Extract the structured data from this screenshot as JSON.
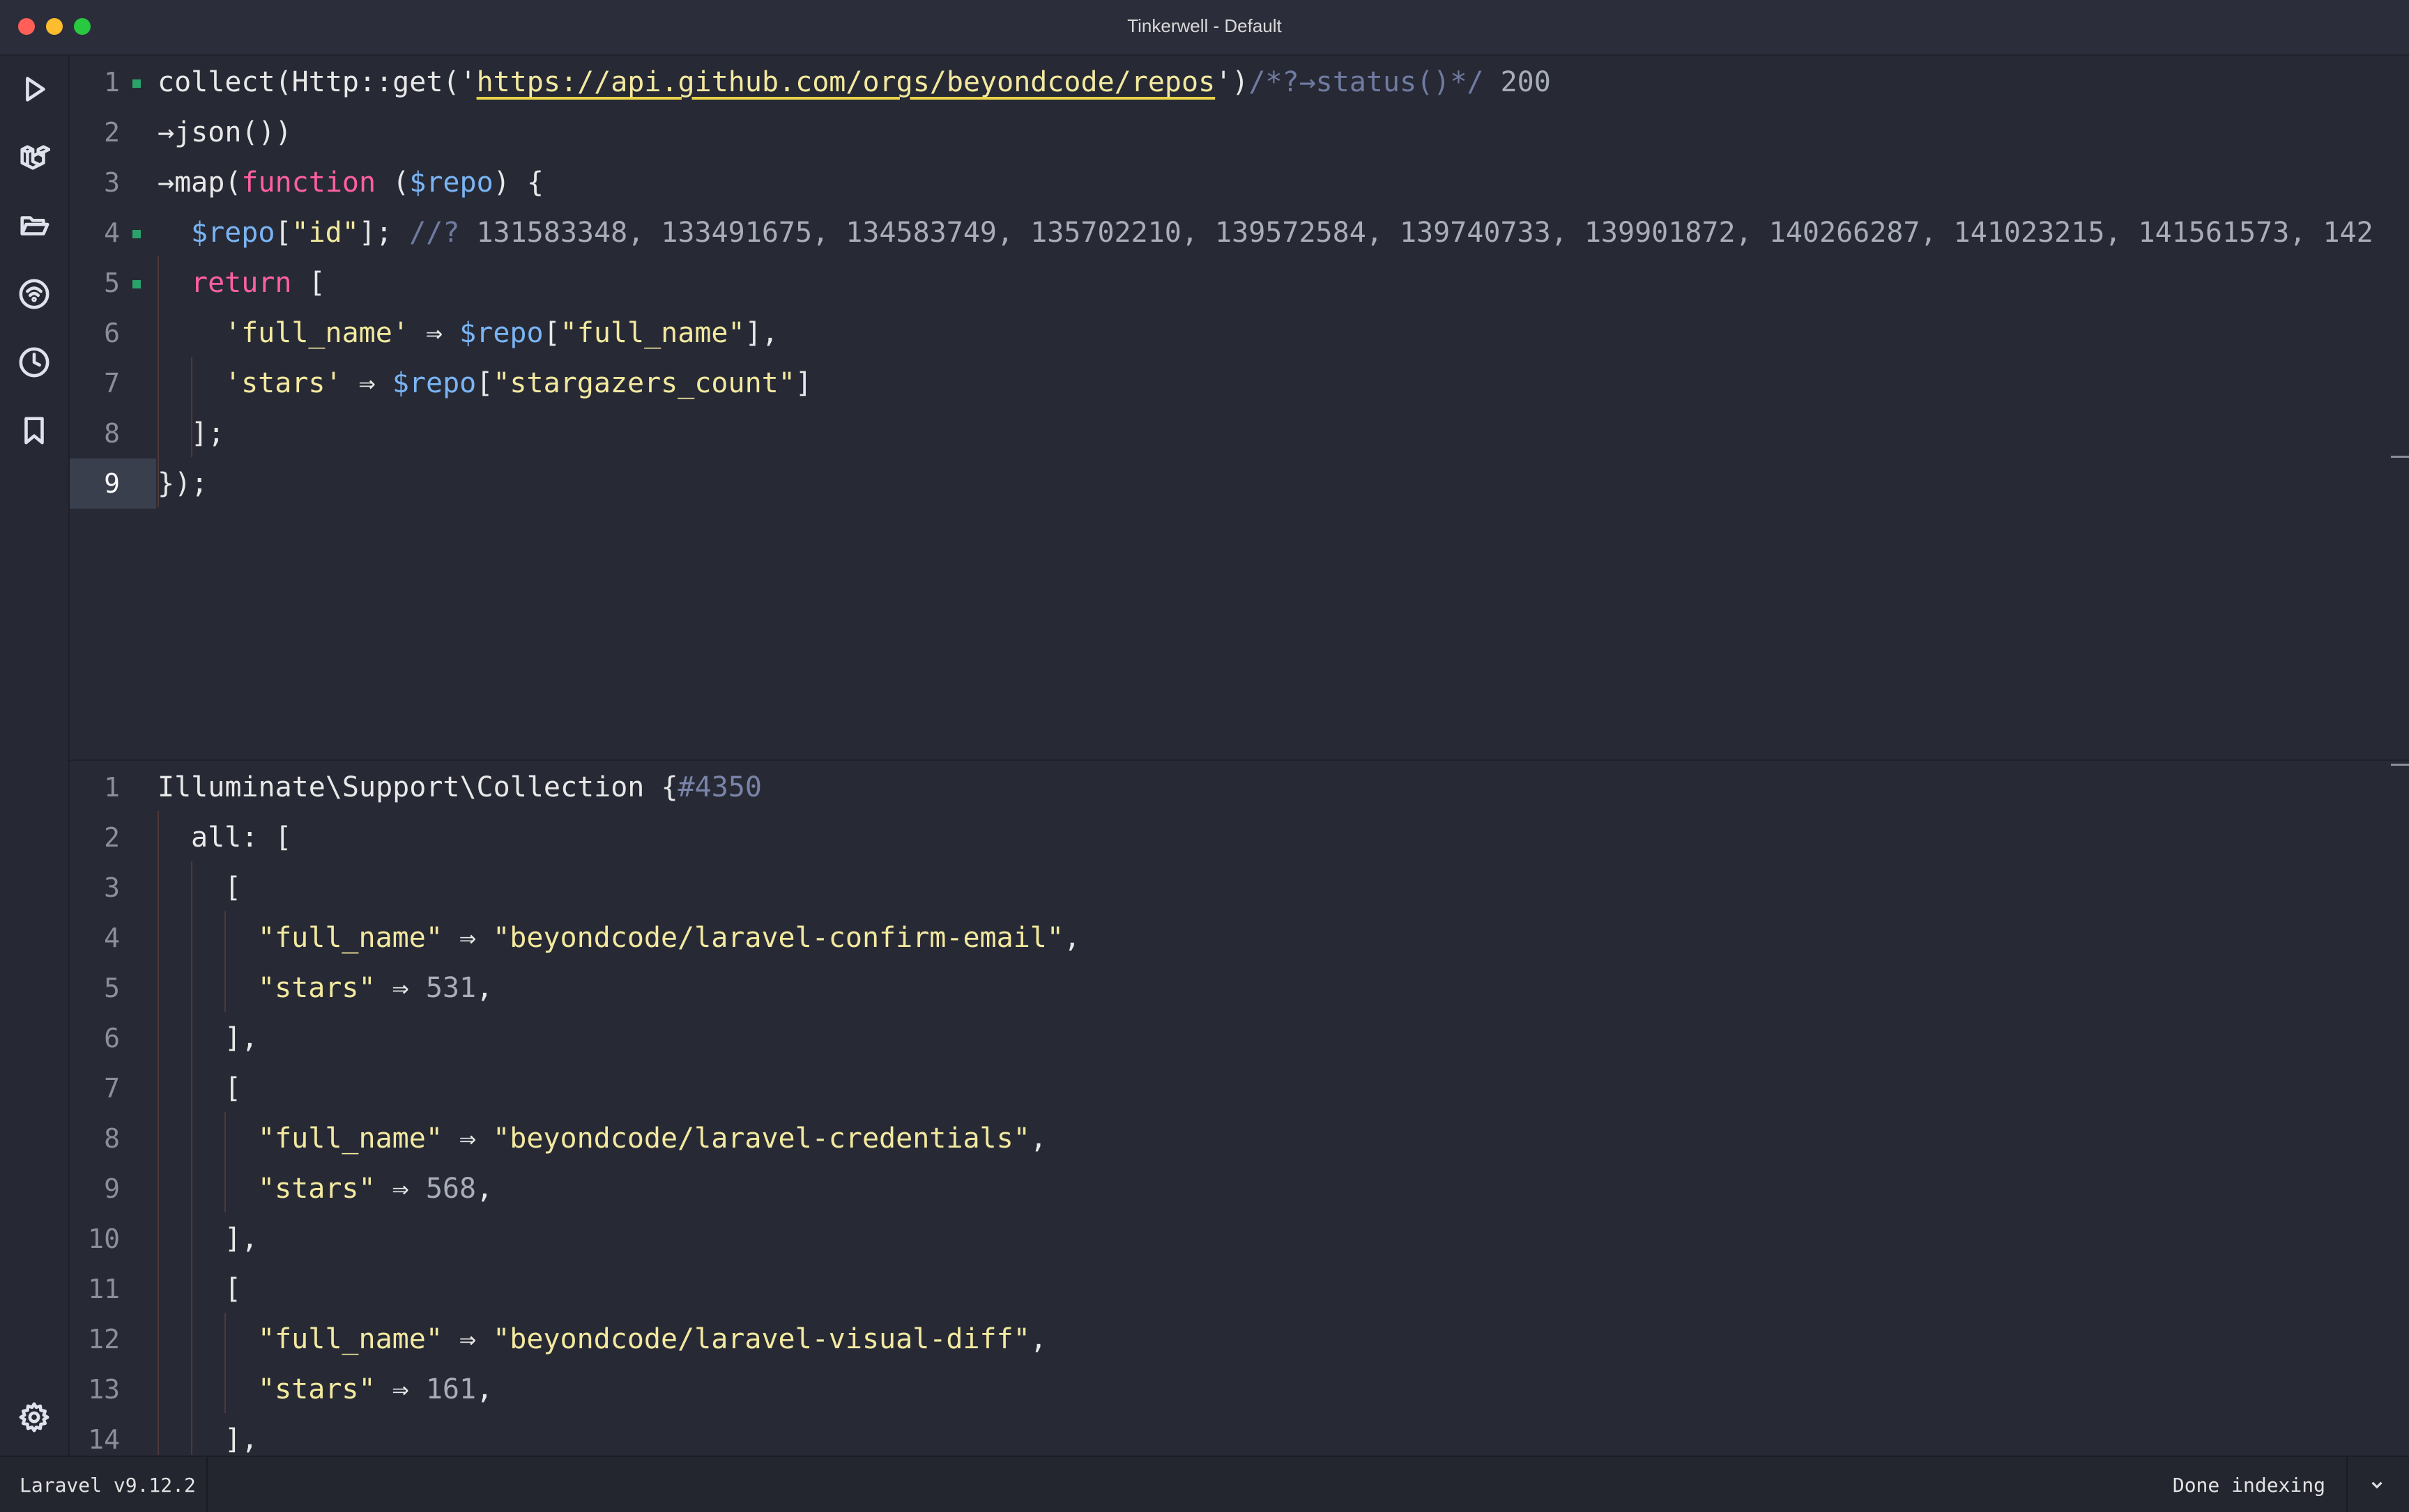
{
  "window": {
    "title": "Tinkerwell - Default"
  },
  "sidebar": {
    "items": [
      {
        "name": "run-icon"
      },
      {
        "name": "laravel-icon"
      },
      {
        "name": "folder-icon"
      },
      {
        "name": "remote-icon"
      },
      {
        "name": "history-icon"
      },
      {
        "name": "bookmark-icon"
      },
      {
        "name": "gear-icon"
      }
    ]
  },
  "editor": {
    "line_numbers": [
      "1",
      "2",
      "3",
      "4",
      "5",
      "6",
      "7",
      "8",
      "9"
    ],
    "l1": {
      "a": "collect(Http::get('",
      "url": "https://api.github.com/orgs/beyondcode/repos",
      "b": "')",
      "cm": "/*?→status()*/",
      "val": "200"
    },
    "l2": {
      "a": "→json())"
    },
    "l3": {
      "a": "→map(",
      "kw": "function",
      "b": " (",
      "var": "$repo",
      "c": ") {"
    },
    "l4": {
      "var": "$repo",
      "a": "[",
      "str": "\"id\"",
      "b": "]; ",
      "cm": "//?",
      "vals": "131583348, 133491675, 134583749, 135702210, 139572584, 139740733, 139901872, 140266287, 141023215, 141561573, 142"
    },
    "l5": {
      "kw": "return",
      "a": " ["
    },
    "l6": {
      "str": "'full_name'",
      "a": " ⇒ ",
      "var": "$repo",
      "b": "[",
      "str2": "\"full_name\"",
      "c": "],"
    },
    "l7": {
      "str": "'stars'",
      "a": " ⇒ ",
      "var": "$repo",
      "b": "[",
      "str2": "\"stargazers_count\"",
      "c": "]"
    },
    "l8": {
      "a": "];"
    },
    "l9": {
      "a": "});"
    }
  },
  "output": {
    "line_numbers": [
      "1",
      "2",
      "3",
      "4",
      "5",
      "6",
      "7",
      "8",
      "9",
      "10",
      "11",
      "12",
      "13",
      "14"
    ],
    "o1": {
      "a": "Illuminate\\Support\\Collection {",
      "hash": "#4350"
    },
    "o2": {
      "a": "all: ["
    },
    "open": "[",
    "close": "],",
    "key_full_name": "\"full_name\"",
    "key_stars": "\"stars\"",
    "arrow": " ⇒ ",
    "repos": [
      {
        "full_name": "\"beyondcode/laravel-confirm-email\"",
        "stars": "531"
      },
      {
        "full_name": "\"beyondcode/laravel-credentials\"",
        "stars": "568"
      },
      {
        "full_name": "\"beyondcode/laravel-visual-diff\"",
        "stars": "161"
      }
    ]
  },
  "statusbar": {
    "version": "Laravel v9.12.2",
    "status": "Done indexing"
  }
}
